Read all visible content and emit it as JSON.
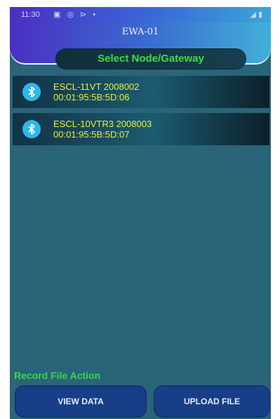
{
  "status_bar": {
    "time": "11:30",
    "icons": "▣ ◎ ⊳ •",
    "right_icons": "◢ ▮"
  },
  "header": {
    "title": "EWA-01",
    "select_label": "Select Node/Gateway"
  },
  "devices": [
    {
      "name": "ESCL-11VT 2008002",
      "mac": "00:01:95:5B:5D:06",
      "icon": "bluetooth-icon"
    },
    {
      "name": "ESCL-10VTR3 2008003",
      "mac": "00:01:95:5B:5D:07",
      "icon": "bluetooth-icon"
    }
  ],
  "record": {
    "label": "Record File Action",
    "view_button": "VIEW DATA",
    "upload_button": "UPLOAD FILE"
  },
  "colors": {
    "background": "#2a6478",
    "accent_green": "#3cdc4a",
    "device_text": "#e8f23a",
    "button": "#173e86",
    "bluetooth": "#2fb6ea"
  }
}
